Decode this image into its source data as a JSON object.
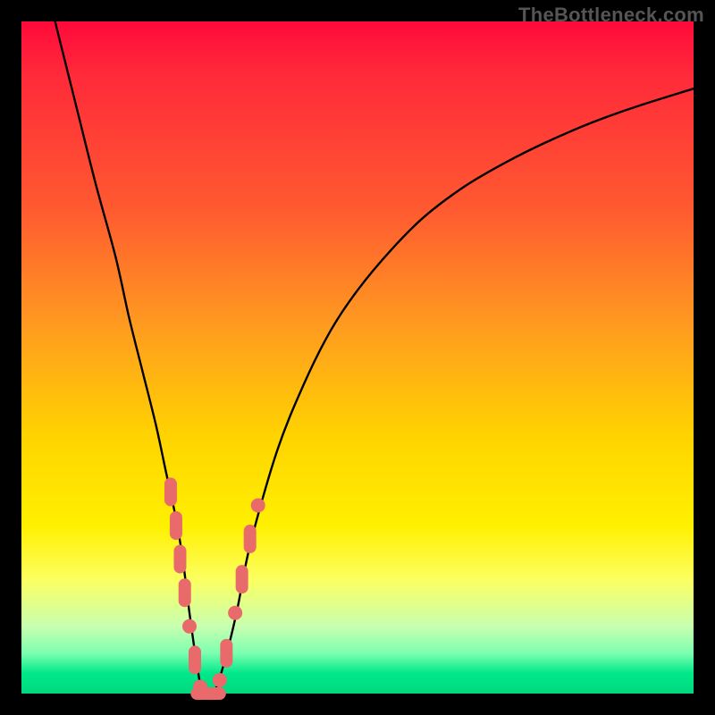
{
  "watermark": "TheBottleneck.com",
  "chart_data": {
    "type": "line",
    "title": "",
    "xlabel": "",
    "ylabel": "",
    "xlim": [
      0,
      100
    ],
    "ylim": [
      0,
      100
    ],
    "series": [
      {
        "name": "bottleneck-curve",
        "x": [
          5,
          8,
          11,
          14,
          16,
          18,
          20,
          21.5,
          23,
          24,
          25,
          26,
          27,
          28.5,
          30,
          32,
          34,
          38,
          42,
          46,
          50,
          55,
          60,
          66,
          72,
          78,
          85,
          92,
          100
        ],
        "y": [
          100,
          88,
          76,
          65,
          56,
          48,
          40,
          33,
          26,
          20,
          12,
          5,
          0,
          0,
          4,
          12,
          22,
          36,
          46,
          54,
          60,
          66,
          71,
          75.5,
          79,
          82,
          85,
          87.5,
          90
        ]
      }
    ],
    "markers": {
      "name": "highlight-points",
      "color": "#e86a6a",
      "points": [
        {
          "x": 22.2,
          "y": 30,
          "shape": "pill-v"
        },
        {
          "x": 23.0,
          "y": 25,
          "shape": "pill-v"
        },
        {
          "x": 23.6,
          "y": 20,
          "shape": "pill-v"
        },
        {
          "x": 24.3,
          "y": 15,
          "shape": "pill-v"
        },
        {
          "x": 25.0,
          "y": 10,
          "shape": "dot"
        },
        {
          "x": 25.8,
          "y": 5,
          "shape": "pill-v"
        },
        {
          "x": 26.6,
          "y": 1,
          "shape": "dot"
        },
        {
          "x": 27.3,
          "y": 0,
          "shape": "pill-h"
        },
        {
          "x": 28.3,
          "y": 0,
          "shape": "pill-h"
        },
        {
          "x": 29.5,
          "y": 2,
          "shape": "dot"
        },
        {
          "x": 30.5,
          "y": 6,
          "shape": "pill-v"
        },
        {
          "x": 31.8,
          "y": 12,
          "shape": "dot"
        },
        {
          "x": 32.8,
          "y": 17,
          "shape": "pill-v"
        },
        {
          "x": 34.0,
          "y": 23,
          "shape": "pill-v"
        },
        {
          "x": 35.2,
          "y": 28,
          "shape": "dot"
        }
      ]
    }
  }
}
